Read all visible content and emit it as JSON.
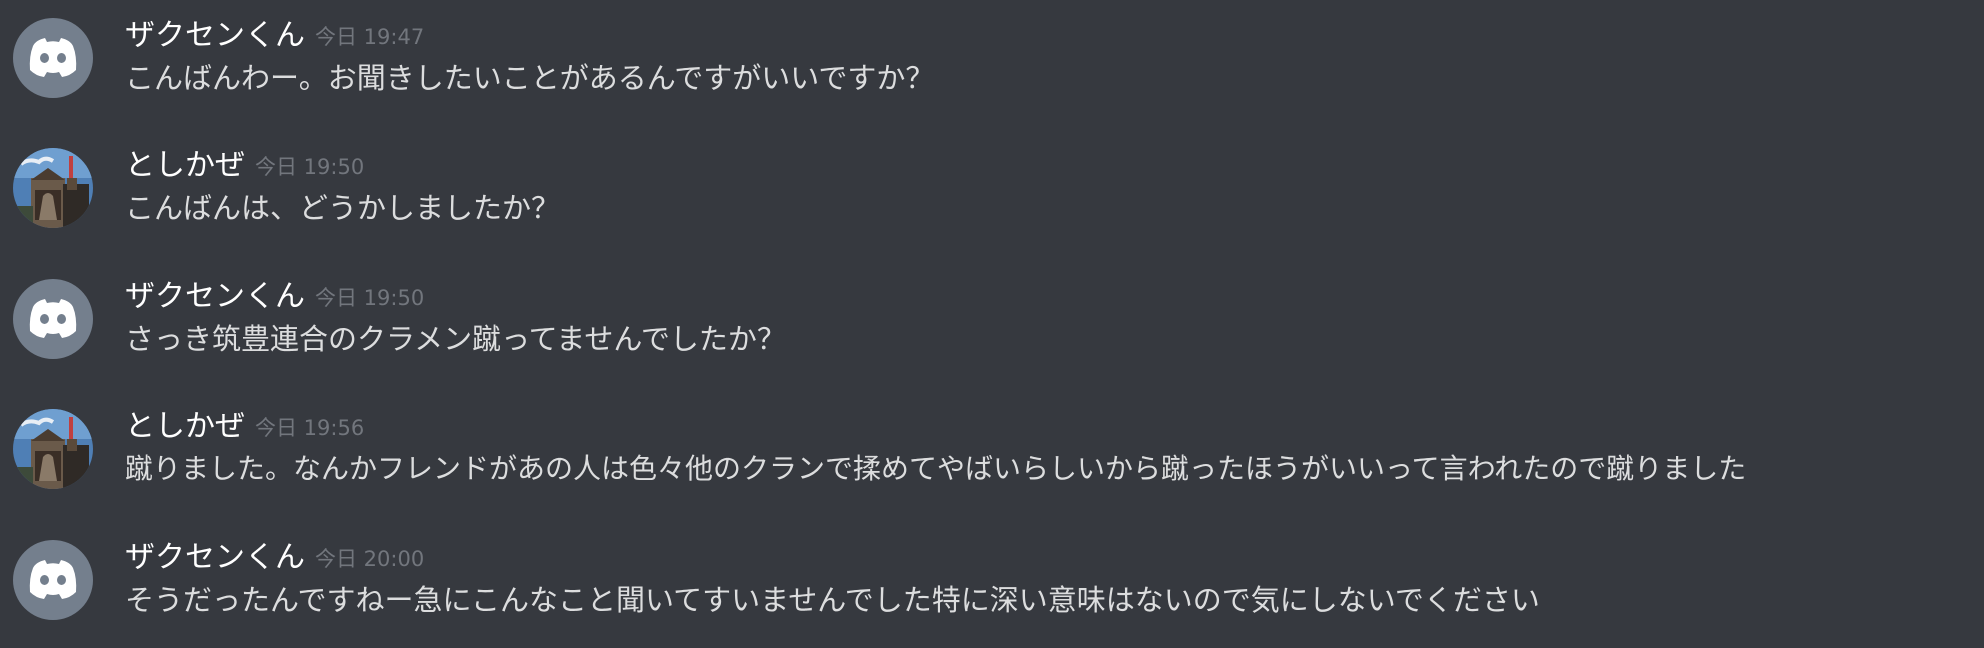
{
  "colors": {
    "background": "#36393f",
    "username": "#ffffff",
    "timestamp": "#72767d",
    "message_text": "#dcddde",
    "default_avatar_bg": "#747f8d"
  },
  "messages": [
    {
      "author": "ザクセンくん",
      "avatar_icon": "discord-default-avatar-icon",
      "timestamp": "今日 19:47",
      "text": "こんばんわー。お聞きしたいことがあるんですがいいですか？"
    },
    {
      "author": "としかぜ",
      "avatar_icon": "user-photo-avatar",
      "timestamp": "今日 19:50",
      "text": "こんばんは、どうかしましたか？"
    },
    {
      "author": "ザクセンくん",
      "avatar_icon": "discord-default-avatar-icon",
      "timestamp": "今日 19:50",
      "text": "さっき筑豊連合のクラメン蹴ってませんでしたか？"
    },
    {
      "author": "としかぜ",
      "avatar_icon": "user-photo-avatar",
      "timestamp": "今日 19:56",
      "text": "蹴りました。なんかフレンドがあの人は色々他のクランで揉めてやばいらしいから蹴ったほうがいいって言われたので蹴りました"
    },
    {
      "author": "ザクセンくん",
      "avatar_icon": "discord-default-avatar-icon",
      "timestamp": "今日 20:00",
      "text": "そうだったんですねー急にこんなこと聞いてすいませんでした特に深い意味はないので気にしないでください"
    }
  ]
}
